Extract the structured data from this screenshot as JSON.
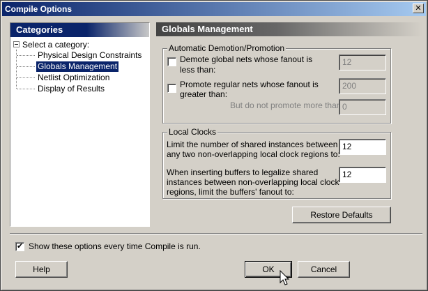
{
  "window": {
    "title": "Compile Options",
    "close_glyph": "✕"
  },
  "categories": {
    "header": "Categories",
    "root_label": "Select a category:",
    "items": [
      {
        "label": "Physical Design Constraints",
        "selected": false
      },
      {
        "label": "Globals Management",
        "selected": true
      },
      {
        "label": "Netlist Optimization",
        "selected": false
      },
      {
        "label": "Display of Results",
        "selected": false
      }
    ]
  },
  "content": {
    "header": "Globals Management",
    "demotion": {
      "title": "Automatic Demotion/Promotion",
      "demote_label_line1": "Demote global nets whose fanout is",
      "demote_label_line2": "less than:",
      "demote_checked": false,
      "demote_value": "12",
      "promote_label_line1": "Promote regular nets whose fanout is",
      "promote_label_line2": "greater than:",
      "promote_checked": false,
      "promote_value": "200",
      "max_promote_label": "But do not promote more than:",
      "max_promote_value": "0"
    },
    "local_clocks": {
      "title": "Local Clocks",
      "limit_label_line1": "Limit the number of shared instances between",
      "limit_label_line2": "any two non-overlapping local clock regions to:",
      "limit_value": "12",
      "buffer_label_line1": "When inserting buffers to legalize shared",
      "buffer_label_line2": "instances between non-overlapping local clock",
      "buffer_label_line3": "regions, limit the buffers' fanout to:",
      "buffer_value": "12"
    },
    "restore_defaults": "Restore Defaults"
  },
  "footer": {
    "show_options_label": "Show these options every time Compile is run.",
    "show_options_checked": true,
    "help": "Help",
    "ok": "OK",
    "cancel": "Cancel"
  }
}
